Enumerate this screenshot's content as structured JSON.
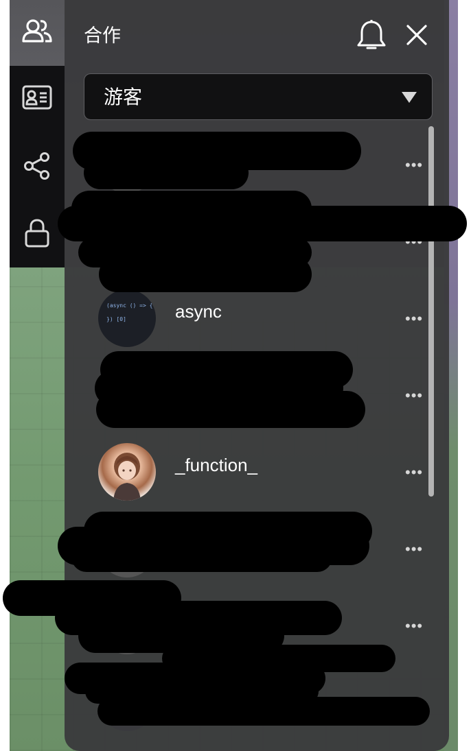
{
  "panel": {
    "title": "合作",
    "role_select": {
      "value": "游客"
    }
  },
  "rail": {
    "items": [
      {
        "icon": "users-icon"
      },
      {
        "icon": "id-card-icon"
      },
      {
        "icon": "share-icon"
      },
      {
        "icon": "lock-icon"
      }
    ]
  },
  "header_icons": [
    "bell-icon",
    "close-icon"
  ],
  "members": [
    {
      "name": "",
      "more": "•••",
      "redacted": true
    },
    {
      "name": "",
      "more": "•••",
      "redacted": true
    },
    {
      "name": "async",
      "more": "•••",
      "avatar_text": "(async () => {\n}) [0]"
    },
    {
      "name": "",
      "more": "•••",
      "redacted": true
    },
    {
      "name": "_function_",
      "more": "•••"
    },
    {
      "name": "",
      "more": "•••",
      "redacted": true
    },
    {
      "name": "",
      "more": "•••",
      "redacted": true
    },
    {
      "name": "",
      "more": "",
      "redacted": true
    }
  ]
}
